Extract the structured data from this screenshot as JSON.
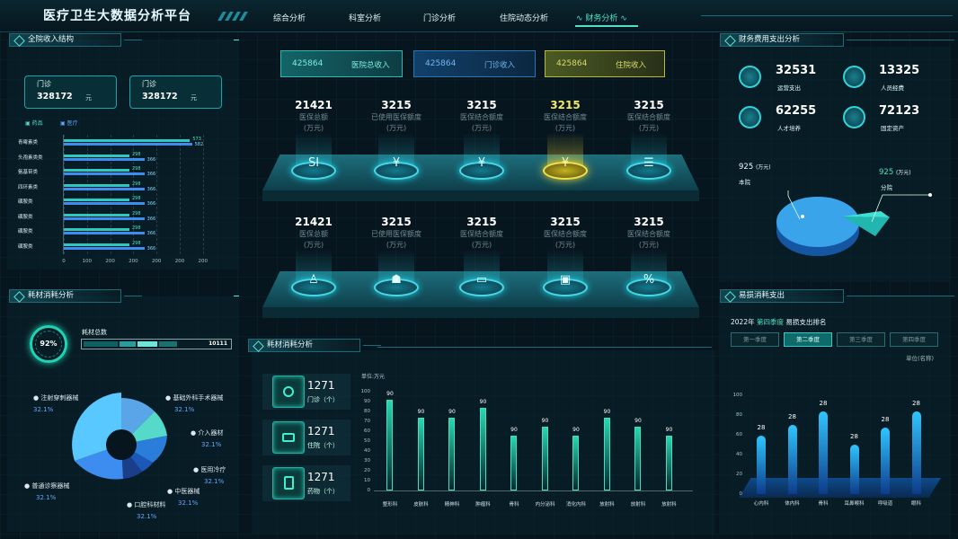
{
  "header": {
    "title": "医疗卫生大数据分析平台",
    "nav": [
      "综合分析",
      "科室分析",
      "门诊分析",
      "住院动态分析",
      "财务分析"
    ],
    "active_index": 4
  },
  "income": {
    "title": "全院收入结构",
    "cards": [
      {
        "label": "门诊",
        "value": "328172",
        "unit": "元"
      },
      {
        "label": "门诊",
        "value": "328172",
        "unit": "元"
      }
    ],
    "legend": [
      "药品",
      "医疗"
    ],
    "rows": [
      {
        "name": "青霉素类",
        "a": 573,
        "b": 582
      },
      {
        "name": "头孢素类类",
        "a": 298,
        "b": 366
      },
      {
        "name": "氨基苷类",
        "a": 298,
        "b": 366
      },
      {
        "name": "四环素类",
        "a": 298,
        "b": 366
      },
      {
        "name": "磺胺类",
        "a": 298,
        "b": 366
      },
      {
        "name": "磺胺类",
        "a": 298,
        "b": 366
      },
      {
        "name": "磺胺类",
        "a": 298,
        "b": 366
      },
      {
        "name": "磺胺类",
        "a": 298,
        "b": 366
      }
    ],
    "xticks": [
      "0",
      "100",
      "200",
      "200",
      "200",
      "200",
      "200"
    ]
  },
  "consume": {
    "title": "耗材消耗分析",
    "percent": "92%",
    "total_label": "耗材总数",
    "total_value": "10111",
    "items": [
      {
        "name": "注射穿刺器械",
        "pct": "32.1%"
      },
      {
        "name": "基础外科手术器械",
        "pct": "32.1%"
      },
      {
        "name": "介入器材",
        "pct": "32.1%"
      },
      {
        "name": "医用冷疗",
        "pct": "32.1%"
      },
      {
        "name": "中医器械",
        "pct": "32.1%"
      },
      {
        "name": "口腔科材料",
        "pct": "32.1%"
      },
      {
        "name": "普通诊察器械",
        "pct": "32.1%"
      }
    ]
  },
  "center": {
    "tabs": [
      {
        "value": "425864",
        "label": "医院总收入"
      },
      {
        "value": "425864",
        "label": "门诊收入"
      },
      {
        "value": "425864",
        "label": "住院收入"
      }
    ],
    "row1": [
      {
        "value": "21421",
        "label": "医保总额",
        "unit": "(万元)",
        "icon": "si-icon"
      },
      {
        "value": "3215",
        "label": "已使用医保额度",
        "unit": "(万元)",
        "icon": "yuan-icon"
      },
      {
        "value": "3215",
        "label": "医保结合额度",
        "unit": "(万元)",
        "icon": "yuan-icon"
      },
      {
        "value": "3215",
        "label": "医保结合额度",
        "unit": "(万元)",
        "icon": "yuan-icon"
      },
      {
        "value": "3215",
        "label": "医保结合额度",
        "unit": "(万元)",
        "icon": "coins-icon"
      }
    ],
    "row2": [
      {
        "value": "21421",
        "label": "医保总额",
        "unit": "(万元)",
        "icon": "doctor-icon"
      },
      {
        "value": "3215",
        "label": "已使用医保额度",
        "unit": "(万元)",
        "icon": "nurse-icon"
      },
      {
        "value": "3215",
        "label": "医保结合额度",
        "unit": "(万元)",
        "icon": "bed-icon"
      },
      {
        "value": "3215",
        "label": "医保结合额度",
        "unit": "(万元)",
        "icon": "ambulance-icon"
      },
      {
        "value": "3215",
        "label": "医保结合额度",
        "unit": "(万元)",
        "icon": "percent-icon"
      }
    ],
    "si_text": "SI",
    "yuan": "¥"
  },
  "materials": {
    "title": "耗材消耗分析",
    "unit": "单位:万元",
    "stats": [
      {
        "value": "1271",
        "label": "门诊（个）"
      },
      {
        "value": "1271",
        "label": "住院（个）"
      },
      {
        "value": "1271",
        "label": "药物（个）"
      }
    ]
  },
  "finance": {
    "title": "财务费用支出分析",
    "items": [
      {
        "value": "32531",
        "label": "运营支出"
      },
      {
        "value": "13325",
        "label": "人员经费"
      },
      {
        "value": "62255",
        "label": "人才培养"
      },
      {
        "value": "72123",
        "label": "固定资产"
      }
    ],
    "pie": [
      {
        "value": "925",
        "unit": "(万元)",
        "label": "本院"
      },
      {
        "value": "925",
        "unit": "(万元)",
        "label": "分院"
      }
    ]
  },
  "loss": {
    "title": "易损消耗支出",
    "year": "2022年",
    "quarter": "第四季度",
    "suffix": "易损支出排名",
    "buttons": [
      "第一季度",
      "第二季度",
      "第三季度",
      "第四季度"
    ],
    "active": 1,
    "unit": "单位(名称)"
  },
  "chart_data": [
    {
      "type": "bar",
      "title": "",
      "categories": [
        "整形科",
        "皮肤科",
        "精神科",
        "肿瘤科",
        "骨科",
        "内分泌科",
        "消化内科",
        "放射科",
        "放射科",
        "放射科"
      ],
      "values": [
        90,
        90,
        90,
        90,
        90,
        90,
        90,
        90,
        90,
        90
      ],
      "ylim": [
        0,
        100
      ],
      "yticks": [
        0,
        10,
        20,
        30,
        40,
        50,
        60,
        70,
        80,
        90,
        100
      ],
      "unit": "单位:万元"
    },
    {
      "type": "bar",
      "title": "",
      "categories": [
        "心内科",
        "体内科",
        "骨科",
        "耳鼻喉科",
        "呼吸道",
        "眼科"
      ],
      "values": [
        28,
        28,
        28,
        28,
        28,
        28
      ],
      "ylim": [
        0,
        100
      ],
      "yticks": [
        0,
        20,
        40,
        60,
        80,
        100
      ]
    }
  ],
  "colors": {
    "accent": "#4be0c8",
    "cyan": "#1ad0e0",
    "gold": "#e2cf33",
    "blue": "#3a8bff"
  }
}
